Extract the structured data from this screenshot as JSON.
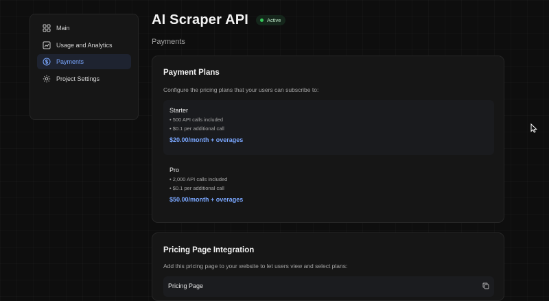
{
  "sidebar": {
    "items": [
      {
        "label": "Main",
        "icon": "grid-icon"
      },
      {
        "label": "Usage and Analytics",
        "icon": "chart-icon"
      },
      {
        "label": "Payments",
        "icon": "dollar-circle-icon",
        "active": true
      },
      {
        "label": "Project Settings",
        "icon": "gear-icon"
      }
    ]
  },
  "header": {
    "title": "AI Scraper API",
    "status": "Active",
    "subtitle": "Payments"
  },
  "payment_plans": {
    "title": "Payment Plans",
    "description": "Configure the pricing plans that your users can subscribe to:",
    "plans": [
      {
        "name": "Starter",
        "features": [
          "• 500 API calls included",
          "• $0.1 per additional call"
        ],
        "price": "$20.00/month + overages"
      },
      {
        "name": "Pro",
        "features": [
          "• 2,000 API calls included",
          "• $0.1 per additional call"
        ],
        "price": "$50.00/month + overages"
      }
    ]
  },
  "integration": {
    "title": "Pricing Page Integration",
    "description": "Add this pricing page to your website to let users view and select plans:",
    "row_label": "Pricing Page"
  },
  "colors": {
    "accent": "#7aa7ff",
    "status_green": "#34c759",
    "background": "#0e0e0e",
    "card": "#161616"
  }
}
